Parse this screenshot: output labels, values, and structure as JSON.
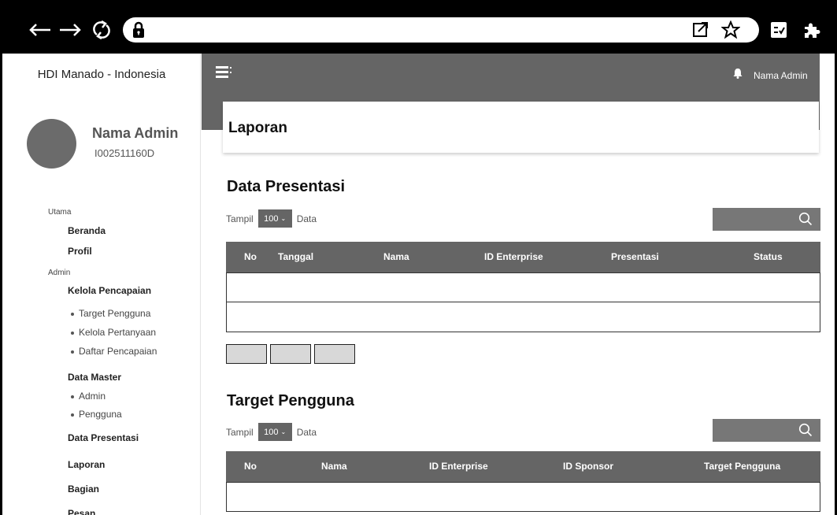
{
  "sidebar": {
    "brand": "HDI Manado - Indonesia",
    "admin_name": "Nama Admin",
    "admin_id": "I002511160D",
    "sections": {
      "main": "Utama",
      "admin": "Admin"
    },
    "items": {
      "beranda": "Beranda",
      "profil": "Profil",
      "kelola_pencapaian": "Kelola Pencapaian",
      "target_pengguna": "Target Pengguna",
      "kelola_pertanyaan": "Kelola Pertanyaan",
      "daftar_pencapaian": "Daftar Pencapaian",
      "data_master": "Data Master",
      "admin": "Admin",
      "pengguna": "Pengguna",
      "data_presentasi": "Data Presentasi",
      "laporan": "Laporan",
      "bagian": "Bagian",
      "pesan": "Pesan"
    }
  },
  "topbar": {
    "admin_name": "Nama Admin",
    "menu_icon": "hamburger-icon",
    "bell_icon": "bell-icon"
  },
  "page": {
    "title": "Laporan"
  },
  "presentasi": {
    "heading": "Data Presentasi",
    "show_label": "Tampil",
    "entries_value": "100",
    "entries_suffix": "Data",
    "columns": [
      "No",
      "Tanggal",
      "Nama",
      "ID Enterprise",
      "Presentasi",
      "Status"
    ],
    "rows": [
      [],
      []
    ],
    "pagination_buttons": [
      "",
      "",
      ""
    ]
  },
  "target": {
    "heading": "Target Pengguna",
    "show_label": "Tampil",
    "entries_value": "100",
    "entries_suffix": "Data",
    "columns": [
      "No",
      "Nama",
      "ID Enterprise",
      "ID Sponsor",
      "Target Pengguna"
    ],
    "rows": [
      []
    ]
  },
  "colors": {
    "topbar": "#656565",
    "table_header": "#656565",
    "search": "#777777",
    "avatar": "#6b6b6b"
  }
}
